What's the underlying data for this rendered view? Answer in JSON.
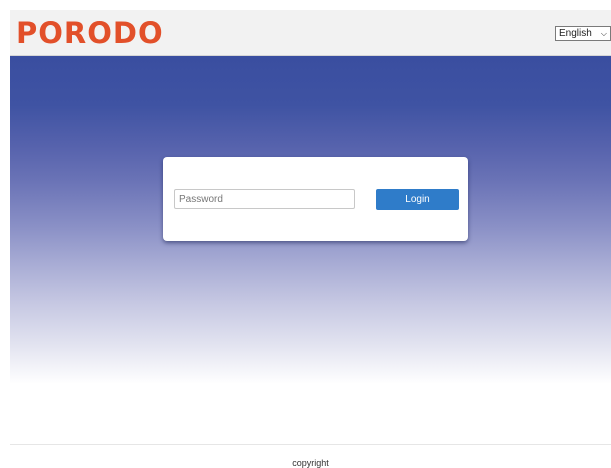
{
  "header": {
    "logo_text": "PORODO",
    "language_selected": "English"
  },
  "login": {
    "password_placeholder": "Password",
    "password_value": "",
    "login_label": "Login"
  },
  "footer": {
    "copyright_text": "copyright"
  },
  "colors": {
    "brand": "#e2502a",
    "primary_button": "#2f7cc9",
    "hero_top": "#3a4ea0",
    "header_bg": "#f2f2f2"
  }
}
